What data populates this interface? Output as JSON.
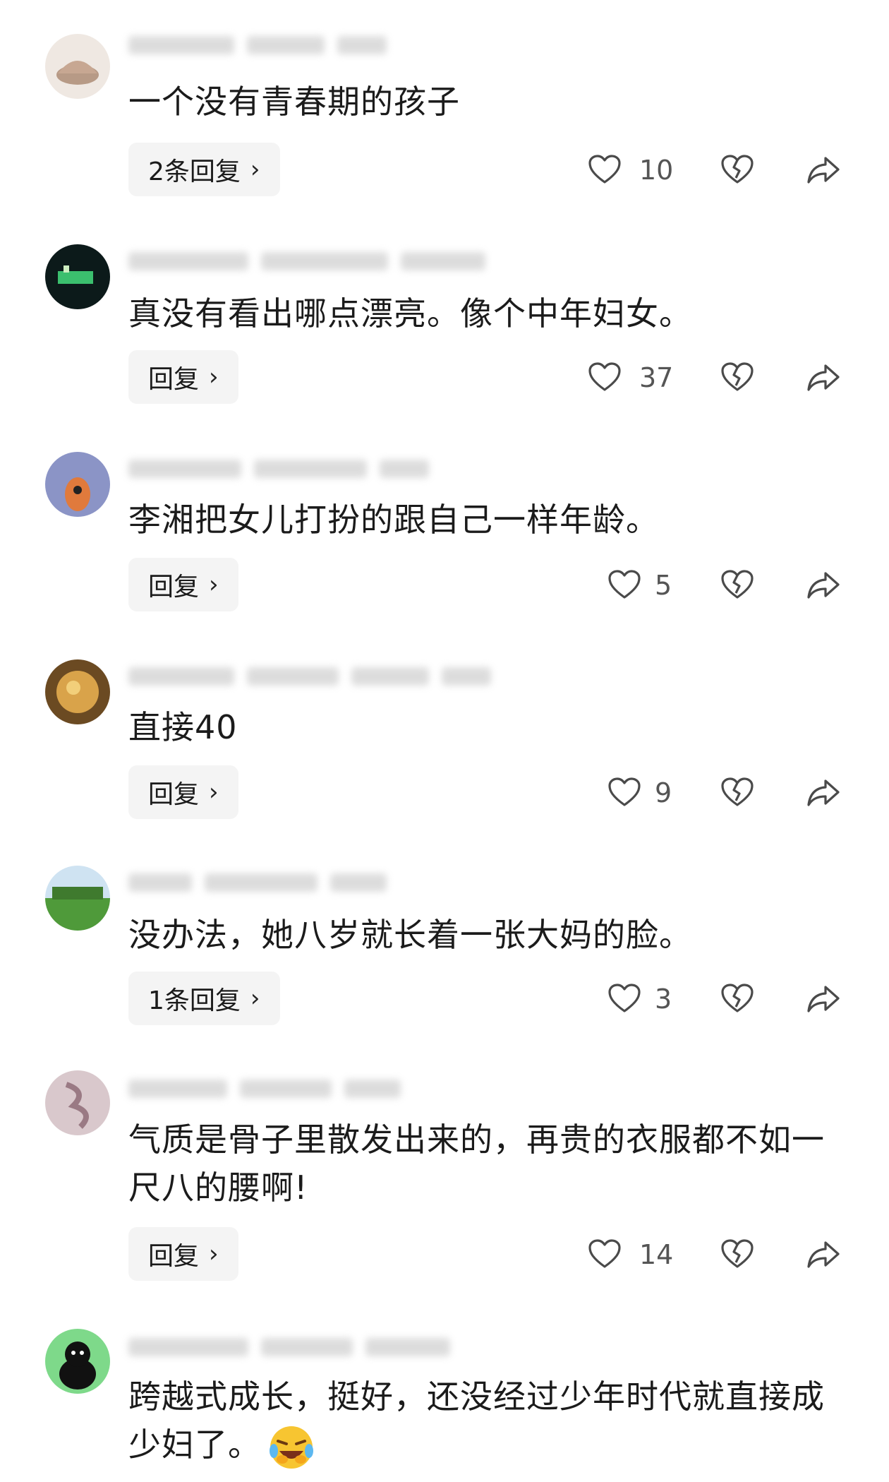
{
  "comments": [
    {
      "text": "一个没有青春期的孩子",
      "reply_label": "2条回复",
      "likes": "10"
    },
    {
      "text": "真没有看出哪点漂亮。像个中年妇女。",
      "reply_label": "回复",
      "likes": "37"
    },
    {
      "text": "李湘把女儿打扮的跟自己一样年龄。",
      "reply_label": "回复",
      "likes": "5"
    },
    {
      "text": "直接40",
      "reply_label": "回复",
      "likes": "9"
    },
    {
      "text": "没办法，她八岁就长着一张大妈的脸。",
      "reply_label": "1条回复",
      "likes": "3"
    },
    {
      "text": "气质是骨子里散发出来的，再贵的衣服都不如一尺八的腰啊!",
      "reply_label": "回复",
      "likes": "14"
    },
    {
      "text": "跨越式成长，挺好，还没经过少年时代就直接成少妇了。",
      "reply_label": "",
      "likes": ""
    }
  ],
  "icons": {
    "like": "heart-outline-icon",
    "dislike": "broken-heart-icon",
    "share": "share-arrow-icon",
    "emoji": "laughing-crying-emoji-icon"
  },
  "colors": {
    "text": "#1b1b1b",
    "count": "#555555",
    "icon": "#4a4a4a",
    "reply_bg": "#f4f4f4"
  }
}
